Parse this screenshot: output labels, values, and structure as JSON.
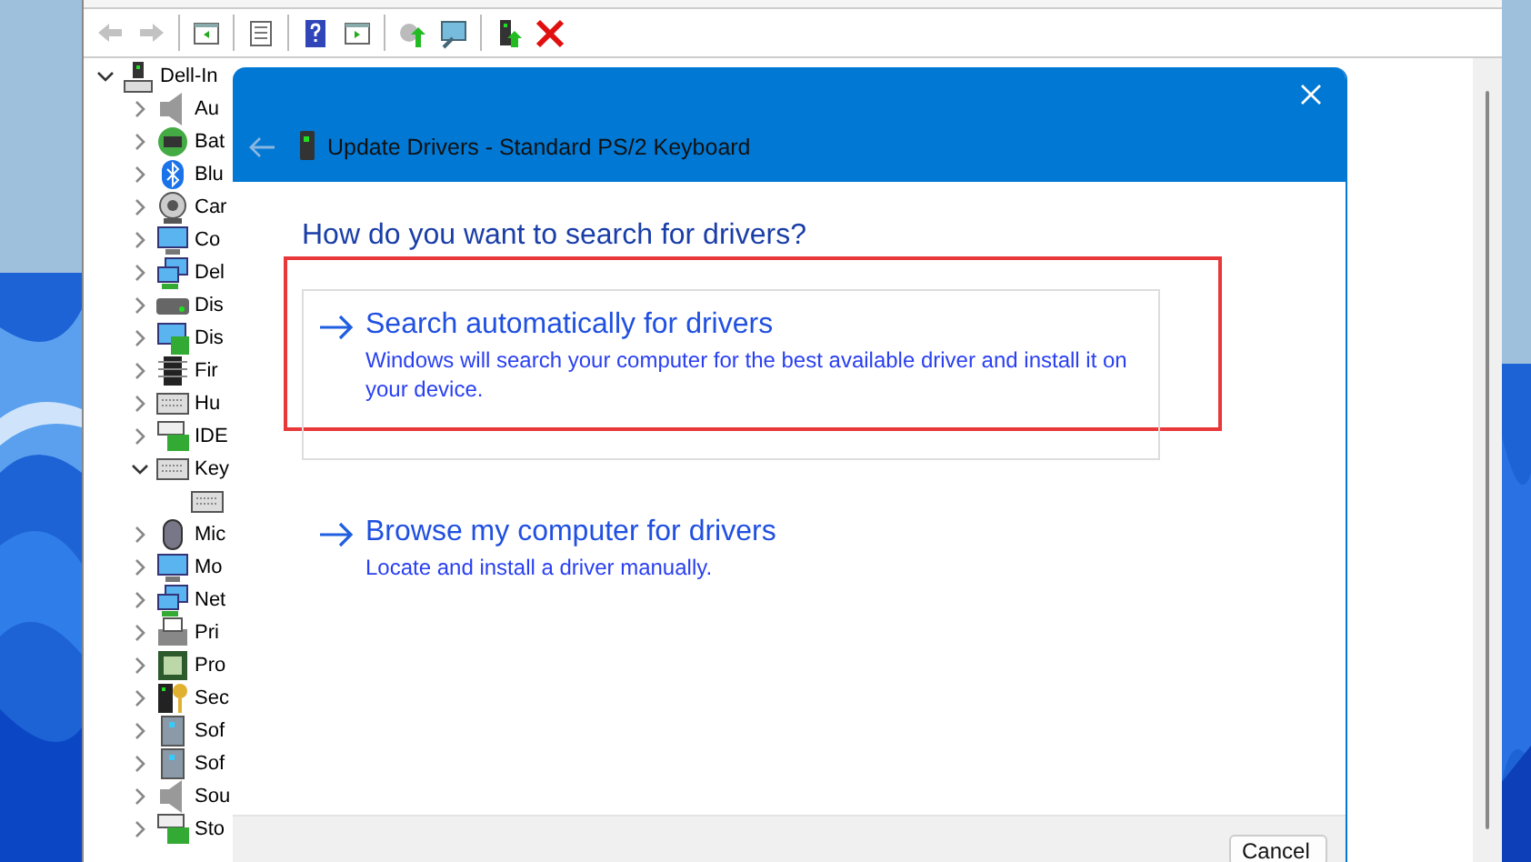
{
  "toolbar": {
    "buttons": [
      {
        "kind": "back",
        "disabled": true
      },
      {
        "kind": "forward",
        "disabled": true
      },
      {
        "kind": "console",
        "disabled": false
      },
      {
        "kind": "properties",
        "disabled": false
      },
      {
        "kind": "help",
        "disabled": false
      },
      {
        "kind": "action",
        "disabled": false
      },
      {
        "kind": "update",
        "disabled": false
      },
      {
        "kind": "scan",
        "disabled": false
      },
      {
        "kind": "enable",
        "disabled": false
      },
      {
        "kind": "uninstall",
        "disabled": false
      }
    ]
  },
  "tree": {
    "root": {
      "label": "Dell-In",
      "expanded": true,
      "children": [
        {
          "label": "Au",
          "expanded": false
        },
        {
          "label": "Bat",
          "expanded": false
        },
        {
          "label": "Blu",
          "expanded": false
        },
        {
          "label": "Car",
          "expanded": false
        },
        {
          "label": "Co",
          "expanded": false
        },
        {
          "label": "Del",
          "expanded": false
        },
        {
          "label": "Dis",
          "expanded": false
        },
        {
          "label": "Dis",
          "expanded": false
        },
        {
          "label": "Fir",
          "expanded": false
        },
        {
          "label": "Hu",
          "expanded": false
        },
        {
          "label": "IDE",
          "expanded": false
        },
        {
          "label": "Key",
          "expanded": true,
          "children": [
            {
              "kind": "device"
            }
          ]
        },
        {
          "label": "Mic",
          "expanded": false
        },
        {
          "label": "Mo",
          "expanded": false
        },
        {
          "label": "Net",
          "expanded": false
        },
        {
          "label": "Pri",
          "expanded": false
        },
        {
          "label": "Pro",
          "expanded": false
        },
        {
          "label": "Sec",
          "expanded": false
        },
        {
          "label": "Sof",
          "expanded": false
        },
        {
          "label": "Sof",
          "expanded": false
        },
        {
          "label": "Sou",
          "expanded": false
        },
        {
          "label": "Sto",
          "expanded": false
        }
      ]
    }
  },
  "dialog": {
    "title": "Update Drivers - Standard PS/2 Keyboard",
    "heading": "How do you want to search for drivers?",
    "options": [
      {
        "title": "Search automatically for drivers",
        "description": "Windows will search your computer for the best available driver and install it on your device.",
        "highlighted": true
      },
      {
        "title": "Browse my computer for drivers",
        "description": "Locate and install a driver manually.",
        "highlighted": false
      }
    ],
    "buttons": [
      "Cancel"
    ]
  }
}
